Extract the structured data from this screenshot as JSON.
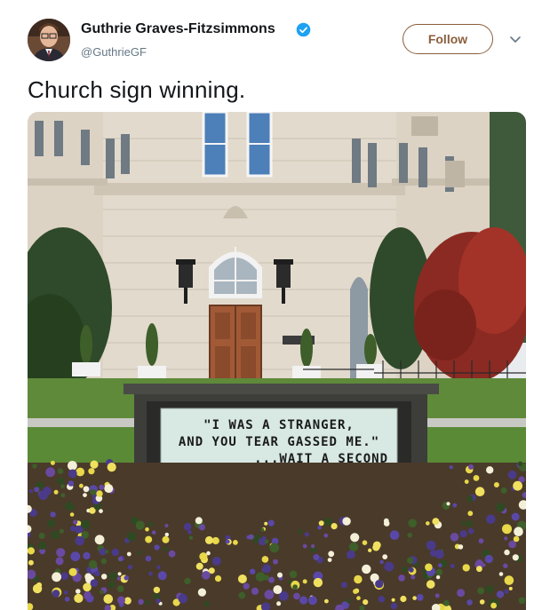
{
  "tweet": {
    "author_name": "Guthrie Graves-Fitzsimmons",
    "handle": "@GuthrieGF",
    "verified_icon": "verified-badge-icon",
    "follow_label": "Follow",
    "text": "Church sign winning."
  },
  "photo": {
    "sign_line_1": "\"I WAS A STRANGER,",
    "sign_line_2": "AND YOU TEAR GASSED ME.\"",
    "sign_line_3": "...WAIT A SECOND"
  },
  "colors": {
    "follow_accent": "#8b5e3c",
    "verified_blue": "#1da1f2",
    "handle_gray": "#657786"
  }
}
